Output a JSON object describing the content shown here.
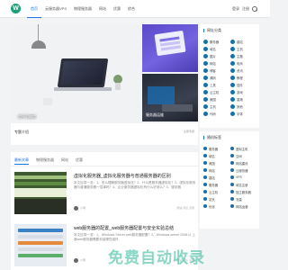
{
  "header": {
    "logo_letter": "W",
    "nav": [
      "首页",
      "云服务器VPS",
      "物理服务器",
      "网站",
      "优惠",
      "综合"
    ],
    "login": "登录",
    "register": "注册"
  },
  "banner": {
    "main_caption": "程序员编程",
    "side1_caption": "",
    "side2_caption": "服务器运维"
  },
  "topic": {
    "title": "专题介绍",
    "more": "全部专题"
  },
  "tabs": [
    "最新文章",
    "物理服务器",
    "网站",
    "优惠"
  ],
  "articles": [
    {
      "title": "虚拟化服务器_虚拟化服务器与普通服务器的区别",
      "excerpt": "本文目录一览：1、怎么理解服务器虚拟化？2、什么是服务器虚拟化？3、虚拟化服务器与普通服务器一招事吗？4、企业服务器虚拟化有什么好用么？5、服务器",
      "author": "小明",
      "stats": "阅读 评论 点赞"
    },
    {
      "title": "web服务器的配置_web服务器配置与安全实验总结",
      "excerpt": "本文目录一览：1、Windows Server web服务器配置？2、Windows server 2008 r2 上面web服务器需要安装哪些组件",
      "author": "小明",
      "stats": "阅读 评论 点赞"
    }
  ],
  "watermark": "免费自动收录",
  "sidebar": {
    "widget1": {
      "title": "网址分类",
      "items": [
        "服务器",
        "建站",
        "域名",
        "主机",
        "图片",
        "主题",
        "网站",
        "电商",
        "博客",
        "资讯",
        "源码",
        "教程",
        "工具",
        "插件",
        "云主机",
        "游戏",
        "美国",
        "香港",
        "主机",
        "其他",
        "代码",
        "字体"
      ]
    },
    "widget2": {
      "title": "随机标签",
      "items": [
        "服务器",
        "虚拟主机",
        "域名",
        "空间",
        "美国",
        "网站建设",
        "网站",
        "云服务器",
        "建站",
        "VPS",
        "服务器",
        "域名注册",
        "云主机",
        "独立服务器",
        "站长",
        "流量",
        "优化",
        "网站运营"
      ]
    }
  },
  "colors": {
    "accent": "#1a73e8",
    "icon": "#1a6fa8",
    "watermark": "#28b496"
  }
}
